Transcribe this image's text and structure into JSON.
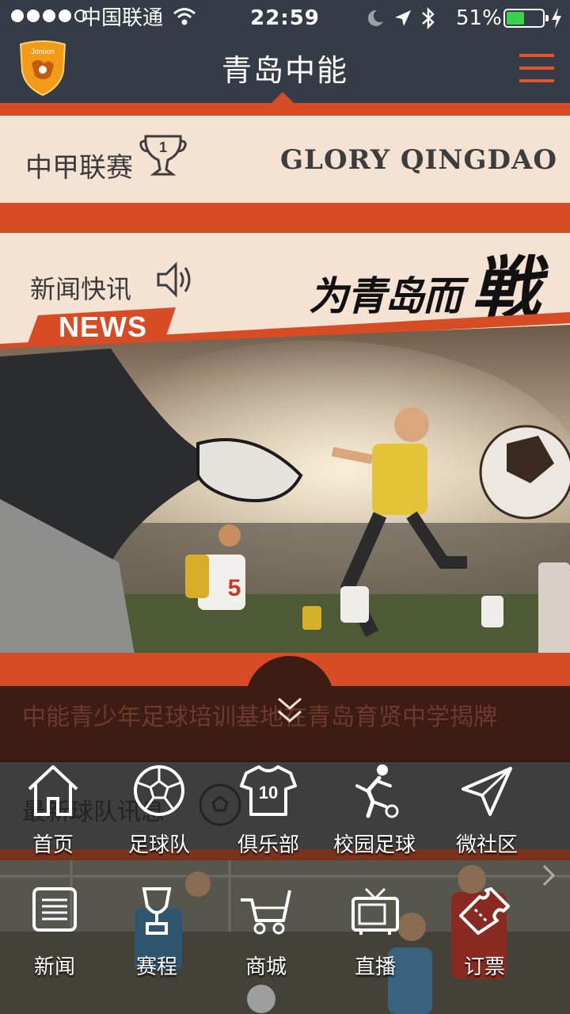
{
  "status_bar": {
    "carrier": "中国联通",
    "time": "22:59",
    "battery_percent_text": "51%",
    "battery_level": 0.51,
    "signal_bars_filled": 4,
    "signal_bars_total": 5
  },
  "nav": {
    "title": "青岛中能",
    "logo_text": "Jonoon",
    "menu_icon": "hamburger-icon"
  },
  "league": {
    "label": "中甲联赛",
    "trophy_number": "1",
    "slogan": "GLORY QINGDAO"
  },
  "news": {
    "label": "新闻快讯",
    "slogan": "为青岛而",
    "slogan_big": "戦",
    "tag": "NEWS",
    "hero_jersey_number": "5"
  },
  "headline": {
    "text": "中能青少年足球培训基地在青岛育贤中学揭牌"
  },
  "team_section": {
    "label": "最新球队讯息"
  },
  "menu": {
    "row1": [
      {
        "label": "首页",
        "icon": "home-icon"
      },
      {
        "label": "足球队",
        "icon": "soccer-ball-icon"
      },
      {
        "label": "俱乐部",
        "icon": "jersey-icon",
        "number": "10"
      },
      {
        "label": "校园足球",
        "icon": "kicking-player-icon"
      },
      {
        "label": "微社区",
        "icon": "paper-plane-icon"
      }
    ],
    "row2": [
      {
        "label": "新闻",
        "icon": "news-list-icon"
      },
      {
        "label": "赛程",
        "icon": "trophy-icon"
      },
      {
        "label": "商城",
        "icon": "shopping-cart-icon"
      },
      {
        "label": "直播",
        "icon": "tv-icon"
      },
      {
        "label": "订票",
        "icon": "ticket-icon"
      }
    ]
  },
  "colors": {
    "navbar": "#353b47",
    "accent": "#d84c25",
    "cream": "#f4e2d2",
    "headline_bg": "#3d1c14"
  }
}
